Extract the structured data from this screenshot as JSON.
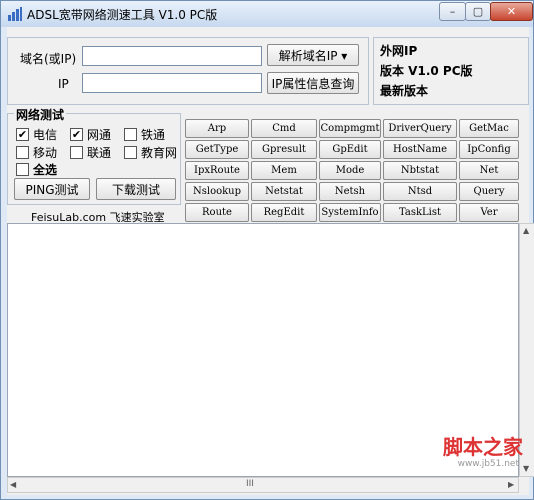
{
  "window": {
    "title": "ADSL宽带网络测速工具 V1.0 PC版",
    "minimize": "–",
    "maximize": "▢",
    "close": "✕"
  },
  "domain_section": {
    "domain_label": "域名(或IP)",
    "domain_value": "",
    "ip_label": "IP",
    "ip_value": "",
    "resolve_button": "解析域名IP ▾",
    "ip_info_button": "IP属性信息查询"
  },
  "info": {
    "external_ip": "外网IP",
    "version": "版本 V1.0 PC版",
    "latest": "最新版本"
  },
  "network_test": {
    "title": "网络测试",
    "options": [
      {
        "label": "电信",
        "checked": true
      },
      {
        "label": "网通",
        "checked": true
      },
      {
        "label": "铁通",
        "checked": false
      },
      {
        "label": "移动",
        "checked": false
      },
      {
        "label": "联通",
        "checked": false
      },
      {
        "label": "教育网",
        "checked": false
      }
    ],
    "select_all": "全选",
    "ping_button": "PING测试",
    "download_button": "下载测试",
    "lab": "FeisuLab.com 飞速实验室"
  },
  "commands": [
    [
      "Arp",
      "Cmd",
      "Compmgmt",
      "DriverQuery",
      "GetMac"
    ],
    [
      "GetType",
      "Gpresult",
      "GpEdit",
      "HostName",
      "IpConfig"
    ],
    [
      "IpxRoute",
      "Mem",
      "Mode",
      "Nbtstat",
      "Net"
    ],
    [
      "Nslookup",
      "Netstat",
      "Netsh",
      "Ntsd",
      "Query"
    ],
    [
      "Route",
      "RegEdit",
      "SystemInfo",
      "TaskList",
      "Ver"
    ]
  ],
  "output_text": "",
  "scrollbar": {
    "up": "▲",
    "down": "▼",
    "left": "◀",
    "right": "▶",
    "thumb": "III"
  },
  "watermark": {
    "text": "脚本之家",
    "url": "www.jb51.net"
  }
}
